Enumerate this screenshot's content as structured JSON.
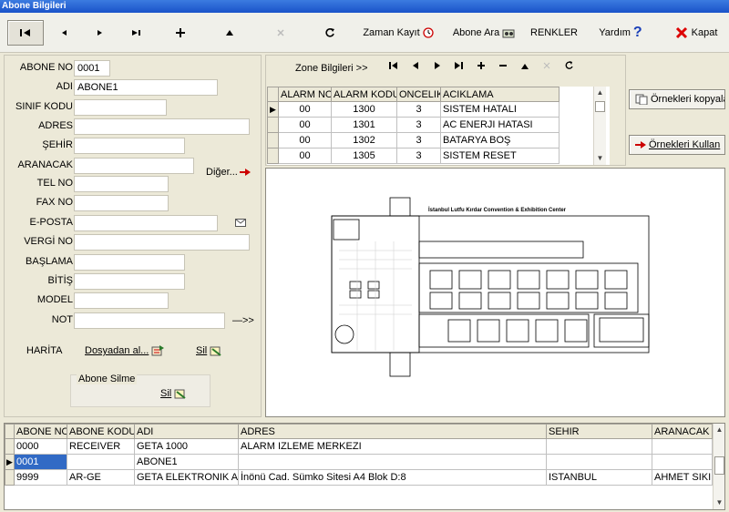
{
  "window": {
    "title": "Abone Bilgileri"
  },
  "toolbar": {
    "zaman_kayit": "Zaman Kayıt",
    "abone_ara": "Abone Ara",
    "renkler": "RENKLER",
    "yardim": "Yardım",
    "kapat": "Kapat"
  },
  "form": {
    "abone_no": {
      "label": "ABONE NO",
      "value": "0001"
    },
    "adi": {
      "label": "ADI",
      "value": "ABONE1"
    },
    "sinif_kodu": {
      "label": "SINIF KODU",
      "value": ""
    },
    "adres": {
      "label": "ADRES",
      "value": ""
    },
    "sehir": {
      "label": "ŞEHİR",
      "value": ""
    },
    "aranacak": {
      "label": "ARANACAK",
      "value": ""
    },
    "diger": "Diğer...",
    "tel_no": {
      "label": "TEL NO",
      "value": ""
    },
    "fax_no": {
      "label": "FAX NO",
      "value": ""
    },
    "e_posta": {
      "label": "E-POSTA",
      "value": ""
    },
    "vergi_no": {
      "label": "VERGİ NO",
      "value": ""
    },
    "baslama": {
      "label": "BAŞLAMA",
      "value": ""
    },
    "bitis": {
      "label": "BİTİŞ",
      "value": ""
    },
    "model": {
      "label": "MODEL",
      "value": ""
    },
    "not": {
      "label": "NOT",
      "value": ""
    },
    "not_arrow": "—>>",
    "harita": "HARİTA",
    "dosyadan_al": "Dosyadan al...",
    "sil": "Sil",
    "abone_silme": "Abone Silme",
    "abone_sil": "Sil"
  },
  "zone": {
    "title": "Zone Bilgileri >>",
    "columns": [
      "ALARM NO",
      "ALARM KODU",
      "ONCELIK",
      "ACIKLAMA"
    ],
    "rows": [
      [
        "00",
        "1300",
        "3",
        "SISTEM HATALI"
      ],
      [
        "00",
        "1301",
        "3",
        "AC ENERJI HATASI"
      ],
      [
        "00",
        "1302",
        "3",
        "BATARYA BOŞ"
      ],
      [
        "00",
        "1305",
        "3",
        "SISTEM RESET"
      ]
    ]
  },
  "buttons": {
    "ornekleri_kopyala": "Örnekleri kopyala",
    "ornekleri_kullan": "Örnekleri Kullan"
  },
  "map": {
    "title": "İstanbul Lutfu Kırdar Convention & Exhibition Center"
  },
  "subscribers": {
    "columns": [
      "ABONE NO",
      "ABONE KODU",
      "ADI",
      "ADRES",
      "SEHIR",
      "ARANACAK"
    ],
    "rows": [
      [
        "0000",
        "RECEIVER",
        "GETA 1000",
        "ALARM  IZLEME MERKEZI",
        "",
        ""
      ],
      [
        "0001",
        "",
        "ABONE1",
        "",
        "",
        ""
      ],
      [
        "9999",
        "AR-GE",
        "GETA ELEKTRONIK A.Ş",
        "İnönü Cad. Sümko Sitesi A4 Blok D:8",
        "ISTANBUL",
        "AHMET SIKI"
      ]
    ]
  }
}
